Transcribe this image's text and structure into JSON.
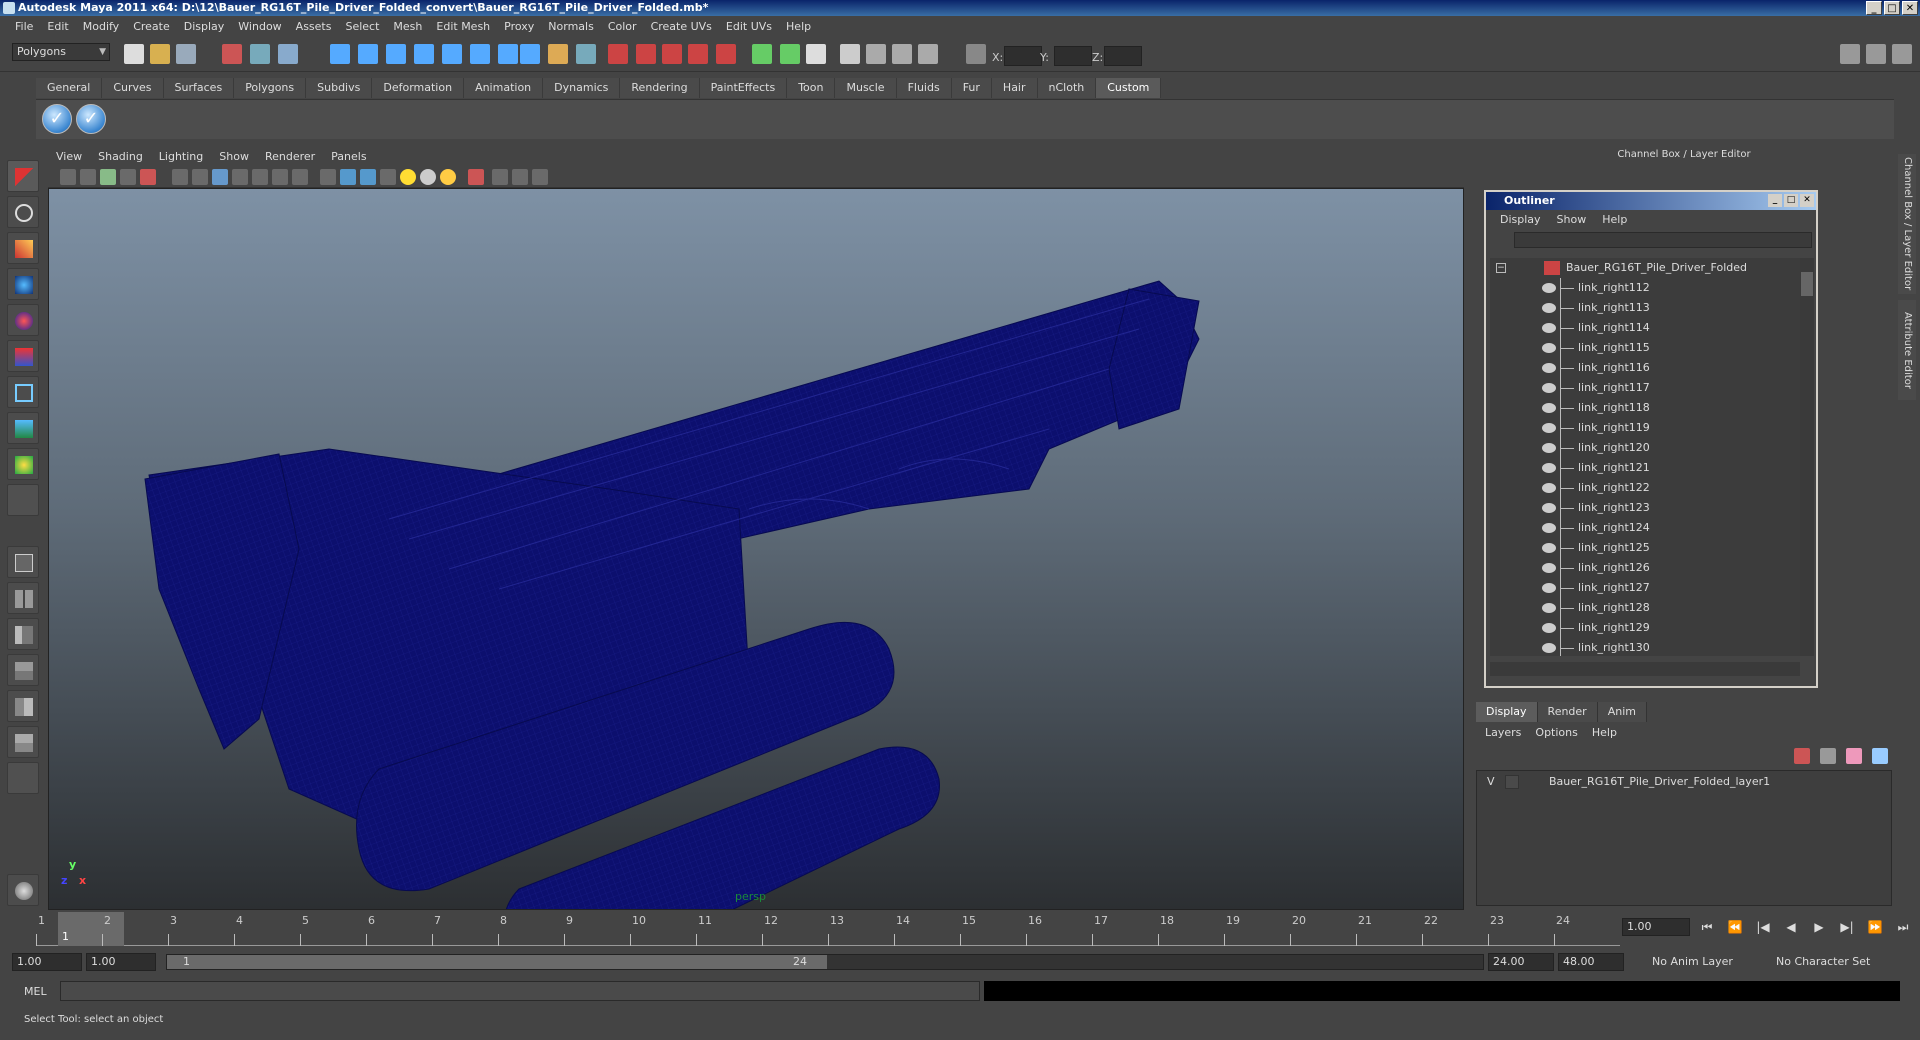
{
  "window": {
    "title": "Autodesk Maya 2011 x64: D:\\12\\Bauer_RG16T_Pile_Driver_Folded_convert\\Bauer_RG16T_Pile_Driver_Folded.mb*",
    "min": "_",
    "max": "□",
    "close": "✕"
  },
  "menubar": [
    "File",
    "Edit",
    "Modify",
    "Create",
    "Display",
    "Window",
    "Assets",
    "Select",
    "Mesh",
    "Edit Mesh",
    "Proxy",
    "Normals",
    "Color",
    "Create UVs",
    "Edit UVs",
    "Help"
  ],
  "status": {
    "mode": "Polygons",
    "x_label": "X:",
    "y_label": "Y:",
    "z_label": "Z:"
  },
  "shelf": {
    "tabs": [
      "General",
      "Curves",
      "Surfaces",
      "Polygons",
      "Subdivs",
      "Deformation",
      "Animation",
      "Dynamics",
      "Rendering",
      "PaintEffects",
      "Toon",
      "Muscle",
      "Fluids",
      "Fur",
      "Hair",
      "nCloth",
      "Custom"
    ],
    "active": "Custom",
    "buttons": [
      "✓",
      "✓"
    ]
  },
  "panel": {
    "menus": [
      "View",
      "Shading",
      "Lighting",
      "Show",
      "Renderer",
      "Panels"
    ],
    "camera": "persp",
    "axis_x": "x",
    "axis_y": "y",
    "axis_z": "z"
  },
  "right": {
    "title": "Channel Box / Layer Editor"
  },
  "outliner": {
    "title": "Outliner",
    "menus": [
      "Display",
      "Show",
      "Help"
    ],
    "root": "Bauer_RG16T_Pile_Driver_Folded",
    "root_toggle": "−",
    "items": [
      "link_right112",
      "link_right113",
      "link_right114",
      "link_right115",
      "link_right116",
      "link_right117",
      "link_right118",
      "link_right119",
      "link_right120",
      "link_right121",
      "link_right122",
      "link_right123",
      "link_right124",
      "link_right125",
      "link_right126",
      "link_right127",
      "link_right128",
      "link_right129",
      "link_right130"
    ]
  },
  "layers": {
    "tabs": [
      "Display",
      "Render",
      "Anim"
    ],
    "active": "Display",
    "menus": [
      "Layers",
      "Options",
      "Help"
    ],
    "rows": [
      {
        "visible": "V",
        "name": "Bauer_RG16T_Pile_Driver_Folded_layer1"
      }
    ]
  },
  "side_tabs": [
    "Channel Box / Layer Editor",
    "Attribute Editor"
  ],
  "timeline": {
    "ticks": [
      "1",
      "2",
      "3",
      "4",
      "5",
      "6",
      "7",
      "8",
      "9",
      "10",
      "11",
      "12",
      "13",
      "14",
      "15",
      "16",
      "17",
      "18",
      "19",
      "20",
      "21",
      "22",
      "23",
      "24"
    ],
    "current": "1",
    "current_field": "1.00",
    "playback": [
      "⏮",
      "⏪",
      "|◀",
      "◀",
      "▶",
      "▶|",
      "⏩",
      "⏭"
    ]
  },
  "range": {
    "start": "1.00",
    "start2": "1.00",
    "slider_start": "1",
    "slider_end": "24",
    "end": "24.00",
    "end2": "48.00",
    "anim_layer": "No Anim Layer",
    "char_set": "No Character Set"
  },
  "command": {
    "label": "MEL"
  },
  "help": {
    "text": "Select Tool: select an object"
  }
}
